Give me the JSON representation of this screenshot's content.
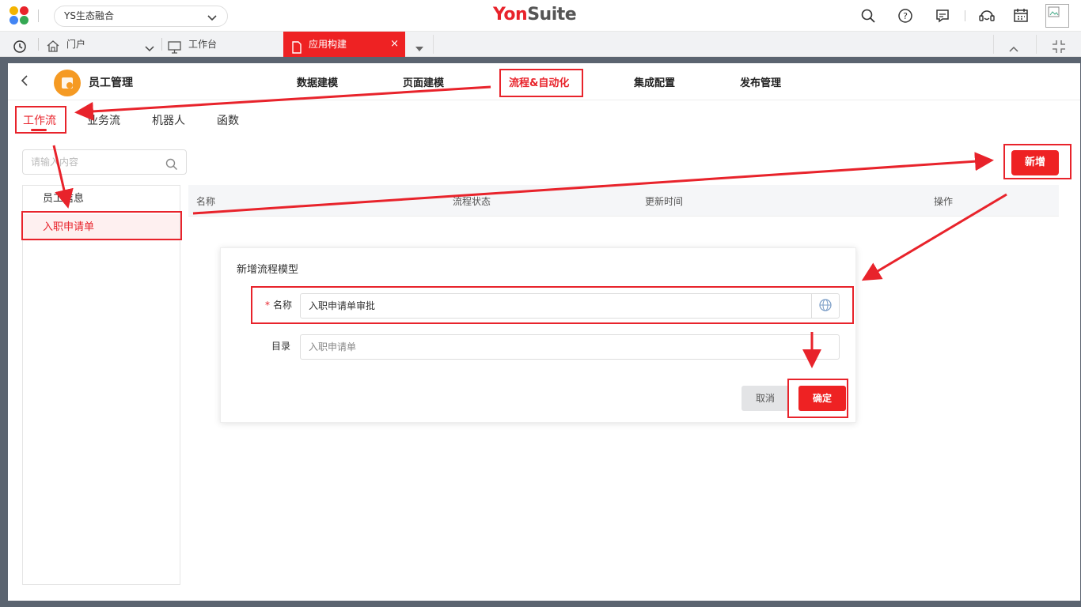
{
  "topbar": {
    "tenant": "YS生态融合",
    "brand_yon": "Yon",
    "brand_suite": "Suite",
    "icons": [
      "search-icon",
      "help-icon",
      "message-icon",
      "service-icon",
      "calendar-icon",
      "avatar-image"
    ]
  },
  "tabs": {
    "portal": "门户",
    "workbench": "工作台",
    "active": "应用构建",
    "close": "×"
  },
  "app": {
    "name": "员工管理",
    "nav": [
      "数据建模",
      "页面建模",
      "流程&自动化",
      "集成配置",
      "发布管理"
    ],
    "active_nav": "流程&自动化"
  },
  "subtabs": [
    "工作流",
    "业务流",
    "机器人",
    "函数"
  ],
  "search": {
    "placeholder": "请输入内容"
  },
  "tree": {
    "items": [
      "员工信息",
      "入职申请单"
    ]
  },
  "toolbar": {
    "new_label": "新增"
  },
  "table": {
    "headers": [
      "名称",
      "流程状态",
      "更新时间",
      "操作"
    ]
  },
  "dialog": {
    "title": "新增流程模型",
    "name_label": "名称",
    "name_required_mark": "*",
    "name_value": "入职申请单审批",
    "dir_label": "目录",
    "dir_value": "入职申请单",
    "cancel": "取消",
    "ok": "确定"
  },
  "colors": {
    "accent": "#e8232b",
    "brand_red": "#ee2223"
  }
}
